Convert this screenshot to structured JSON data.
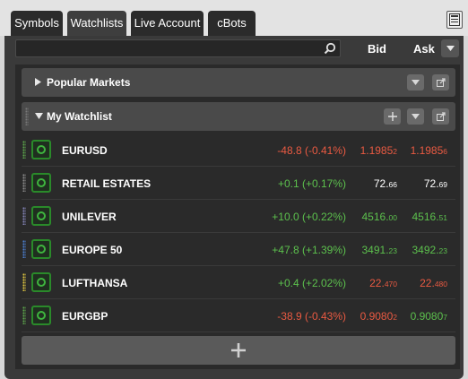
{
  "tabs": [
    {
      "label": "Symbols",
      "active": false
    },
    {
      "label": "Watchlists",
      "active": true
    },
    {
      "label": "Live Account",
      "active": false
    },
    {
      "label": "cBots",
      "active": false
    }
  ],
  "header": {
    "search_placeholder": "",
    "bid_label": "Bid",
    "ask_label": "Ask"
  },
  "groups": [
    {
      "title": "Popular Markets",
      "collapsed": true
    },
    {
      "title": "My Watchlist",
      "collapsed": false
    }
  ],
  "rows": [
    {
      "name": "EURUSD",
      "change": "-48.8 (-0.41%)",
      "dir": "dn",
      "bid_main": "1.1985",
      "bid_sub": "2",
      "bid_color": "dn",
      "ask_main": "1.1985",
      "ask_sub": "6",
      "ask_color": "dn",
      "band": "#5aa04a"
    },
    {
      "name": "RETAIL ESTATES",
      "change": "+0.1 (+0.17%)",
      "dir": "up",
      "bid_main": "72.",
      "bid_sub": "66",
      "bid_color": "wh",
      "ask_main": "72.",
      "ask_sub": "69",
      "ask_color": "wh",
      "band": "#888888"
    },
    {
      "name": "UNILEVER",
      "change": "+10.0 (+0.22%)",
      "dir": "up",
      "bid_main": "4516.",
      "bid_sub": "00",
      "bid_color": "up",
      "ask_main": "4516.",
      "ask_sub": "51",
      "ask_color": "up",
      "band": "#8080b0"
    },
    {
      "name": "EUROPE 50",
      "change": "+47.8 (+1.39%)",
      "dir": "up",
      "bid_main": "3491.",
      "bid_sub": "23",
      "bid_color": "up",
      "ask_main": "3492.",
      "ask_sub": "23",
      "ask_color": "up",
      "band": "#4a7ac8"
    },
    {
      "name": "LUFTHANSA",
      "change": "+0.4 (+2.02%)",
      "dir": "up",
      "bid_main": "22.",
      "bid_sub": "470",
      "bid_color": "dn",
      "ask_main": "22.",
      "ask_sub": "480",
      "ask_color": "dn",
      "band": "#d8c040"
    },
    {
      "name": "EURGBP",
      "change": "-38.9 (-0.43%)",
      "dir": "dn",
      "bid_main": "0.9080",
      "bid_sub": "2",
      "bid_color": "dn",
      "ask_main": "0.9080",
      "ask_sub": "7",
      "ask_color": "up",
      "band": "#5aa04a"
    }
  ],
  "colors": {
    "up": "#5cc04d",
    "down": "#ea5a42",
    "star_border": "#2a8a2a"
  },
  "icons": {
    "panel": "panel-layout-icon",
    "search": "search-icon",
    "dropdown": "chevron-down-icon",
    "collapsed": "triangle-right-icon",
    "expanded": "triangle-down-icon",
    "add": "plus-icon",
    "popout": "external-link-icon",
    "star": "favorite-icon"
  }
}
